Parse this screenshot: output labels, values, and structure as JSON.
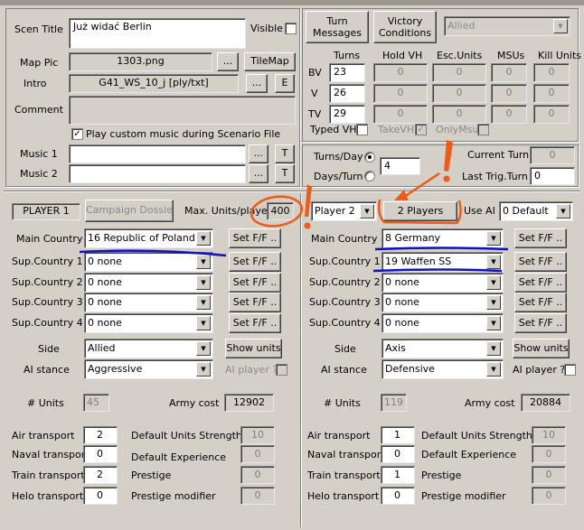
{
  "scenario": {
    "title_label": "Scen Title",
    "title_value": "Już widać Berlin",
    "visible_label": "Visible",
    "map_pic_label": "Map Pic",
    "map_pic_value": "1303.png",
    "browse_label": "...",
    "tilemap_label": "TileMap",
    "intro_label": "Intro",
    "intro_value": "G41_WS_10_j  [ply/txt]",
    "intro_e_label": "E",
    "comment_label": "Comment",
    "play_music_label": "Play custom music during Scenario File",
    "music1_label": "Music 1",
    "music2_label": "Music 2",
    "t_label": "T"
  },
  "top_right": {
    "turn_messages": "Turn Messages",
    "victory_conditions": "Victory Conditions",
    "side_select": "Allied",
    "headers": [
      "Turns",
      "Hold VH",
      "Esc.Units",
      "MSUs",
      "Kill Units"
    ],
    "rows": [
      {
        "label": "BV",
        "values": [
          "23",
          "0",
          "0",
          "0",
          "0"
        ]
      },
      {
        "label": "V",
        "values": [
          "26",
          "0",
          "0",
          "0",
          "0"
        ]
      },
      {
        "label": "TV",
        "values": [
          "29",
          "0",
          "0",
          "0",
          "0"
        ]
      }
    ],
    "typed_vh": "Typed VH",
    "take_vh": "TakeVH",
    "only_msu": "OnlyMsu",
    "turns_day": "Turns/Day",
    "days_turn": "Days/Turn",
    "turns_value": "4",
    "current_turn_label": "Current Turn",
    "current_turn_value": "0",
    "last_trig_label": "Last Trig.Turn",
    "last_trig_value": "0"
  },
  "player1_bar": {
    "player_label": "PLAYER 1",
    "campaign_dossier": "Campaign Dossier",
    "max_units_label": "Max. Units/player",
    "max_units_value": "400"
  },
  "player2_bar": {
    "player_select": "Player 2",
    "players_button": "2 Players",
    "use_ai_label": "Use AI",
    "use_ai_value": "0  Default"
  },
  "labels": {
    "main_country": "Main Country",
    "sup1": "Sup.Country 1",
    "sup2": "Sup.Country 2",
    "sup3": "Sup.Country 3",
    "sup4": "Sup.Country 4",
    "setff": "Set F/F ..",
    "side": "Side",
    "show_units": "Show units",
    "ai_stance": "AI stance",
    "ai_player": "AI player ?",
    "units": "# Units",
    "army_cost": "Army cost",
    "air": "Air transport",
    "naval": "Naval transport",
    "train": "Train  transport",
    "helo": "Helo  transport",
    "dus": "Default Units Strength",
    "dexp": "Default Experience",
    "prestige": "Prestige",
    "prestige_mod": "Prestige modifier"
  },
  "player1": {
    "countries": [
      "16 Republic of Poland",
      "0 none",
      "0 none",
      "0 none",
      "0 none"
    ],
    "side": "Allied",
    "ai_stance": "Aggressive",
    "units": "45",
    "army_cost": "12902",
    "air": "2",
    "naval": "0",
    "train": "2",
    "helo": "0",
    "dus": "10",
    "dexp": "0",
    "prestige": "0",
    "prestige_mod": "0"
  },
  "player2": {
    "countries": [
      "8  Germany",
      "19 Waffen SS",
      "0 none",
      "0 none",
      "0 none"
    ],
    "side": "Axis",
    "ai_stance": "Defensive",
    "units": "119",
    "army_cost": "20884",
    "air": "1",
    "naval": "0",
    "train": "1",
    "helo": "0",
    "dus": "10",
    "dexp": "0",
    "prestige": "0",
    "prestige_mod": "0"
  },
  "annotations": {
    "exclamation": "!",
    "colors": {
      "orange": "#f05a14",
      "blue": "#1010c8"
    }
  }
}
